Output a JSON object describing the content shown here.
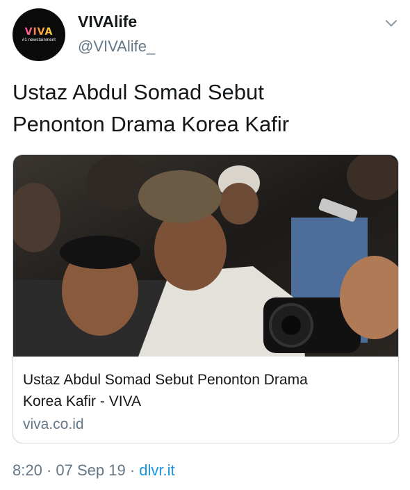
{
  "author": {
    "display_name": "VIVAlife",
    "handle": "@VIVAlife_",
    "avatar": {
      "logo_text": "VIVA",
      "tagline": "#1 newstainment"
    }
  },
  "tweet": {
    "text_line1": "Ustaz Abdul Somad Sebut",
    "text_line2": "Penonton Drama Korea Kafir"
  },
  "card": {
    "image_description": "news photo",
    "title_line1": "Ustaz Abdul Somad Sebut Penonton Drama",
    "title_line2": "Korea Kafir - VIVA",
    "domain": "viva.co.id"
  },
  "meta": {
    "time": "8:20",
    "separator1": " · ",
    "date": "07 Sep 19",
    "separator2": " · ",
    "source": "dlvr.it"
  },
  "icons": {
    "menu": "chevron-down-icon"
  },
  "colors": {
    "text_primary": "#14171a",
    "text_secondary": "#657786",
    "link": "#1b95e0",
    "border": "#ccd6dd"
  }
}
